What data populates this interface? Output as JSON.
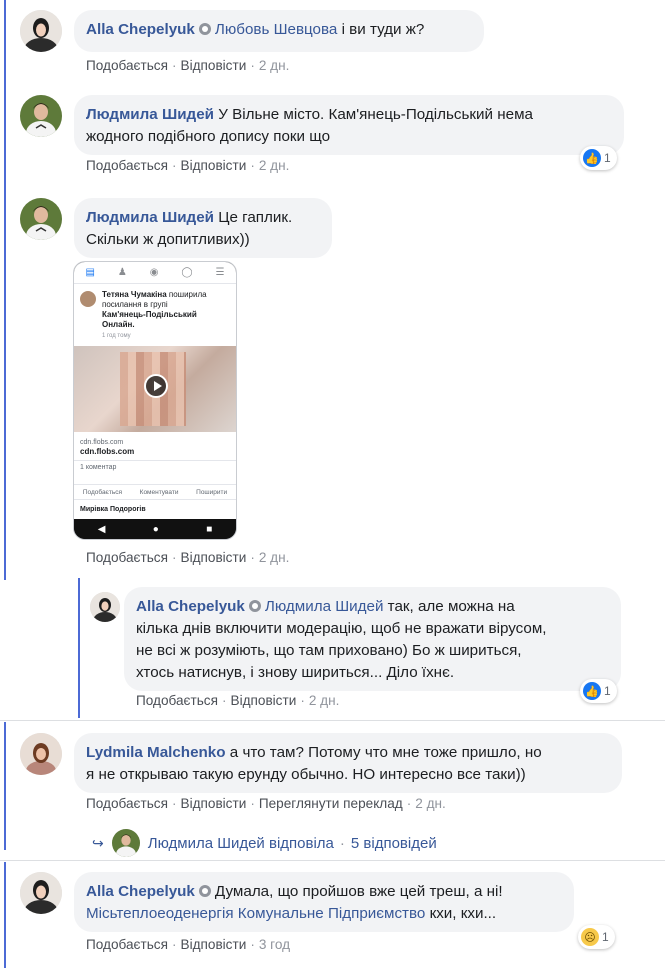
{
  "ui": {
    "like_label": "Подобається",
    "reply_label": "Відповісти",
    "translate_label": "Переглянути переклад"
  },
  "comments": [
    {
      "author": "Alla Chepelyuk",
      "mention": "Любовь Шевцова",
      "text": " і ви туди ж?",
      "time": "2 дн.",
      "verified": true
    },
    {
      "author": "Людмила Шидей",
      "line1": "У Вільне місто. Кам'янець-Подільський нема",
      "line2": "жодного подібного допису поки що",
      "time": "2 дн.",
      "reaction_count": "1"
    },
    {
      "author": "Людмила Шидей",
      "line1": "Це гаплик.",
      "line2": "Скільки ж допитливих))",
      "time": "2 дн."
    },
    {
      "author": "Alla Chepelyuk",
      "mention": "Людмила Шидей",
      "line1": "так, але можна на",
      "line2": "кілька днів включити модерацію, щоб не вражати вірусом,",
      "line3": "не всі ж розуміють, що там приховано) Бо ж шириться,",
      "line4": "хтось натиснув, і знову шириться... Діло їхнє.",
      "time": "2 дн.",
      "reaction_count": "1",
      "verified": true
    },
    {
      "author": "Lydmila Malchenko",
      "line1": "а что там? Потому что мне тоже пришло, но",
      "line2": "я не открываю такую ерунду обычно. НО интересно все таки))",
      "time": "2 дн."
    },
    {
      "author": "Alla Chepelyuk",
      "line1": "Думала, що пройшов вже цей треш, а ні!",
      "mention": "Місьтеплоеоденергія Комунальне Підприємство",
      "tail": " кхи, кхи...",
      "time": "3 год",
      "reaction_count": "1",
      "verified": true
    }
  ],
  "replies_summary": {
    "who": "Людмила Шидей відповіла",
    "count": "5 відповідей"
  },
  "shared_shot": {
    "poster": "Тетяна Чумакіна",
    "action": "поширила посилання в групі",
    "group": "Кам'янець-Подільський Онлайн.",
    "time": "1 год тому",
    "link_domain": "cdn.flobs.com",
    "link_title": "cdn.flobs.com",
    "comment_count": "1 коментар",
    "actions": [
      "Подобається",
      "Коментувати",
      "Поширити"
    ],
    "next_author": "Мирівка Подорогів"
  },
  "colors": {
    "author": "#385898",
    "bubble": "#f2f3f5",
    "thread_line": "#4c6ad5",
    "like_blue": "#1877f2"
  }
}
